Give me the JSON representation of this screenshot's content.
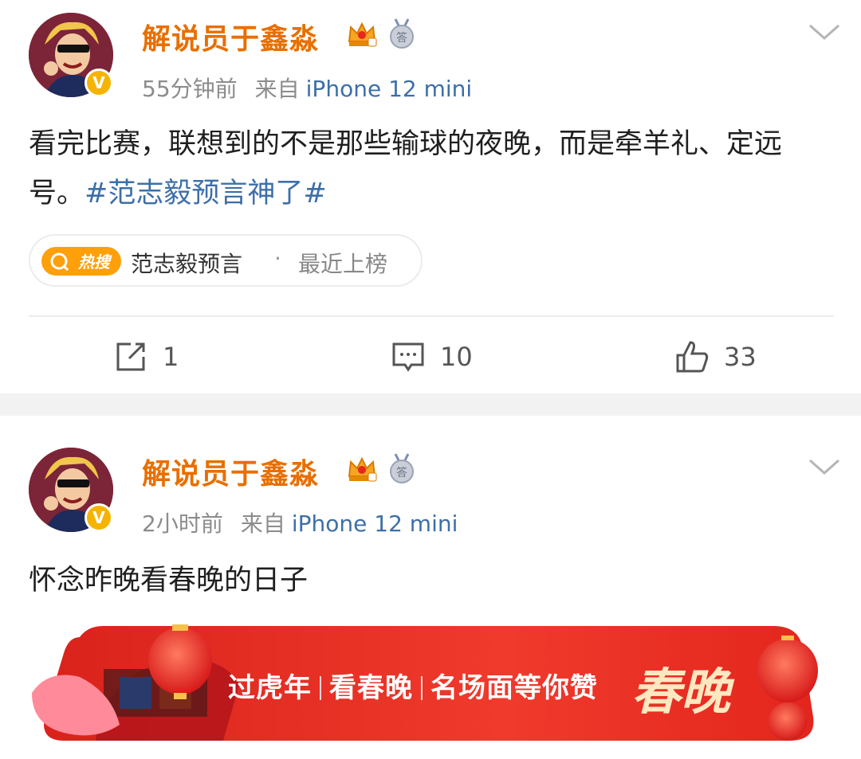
{
  "colors": {
    "username": "#e86f00",
    "link": "#3d6fa8",
    "meta": "#8c8c8c",
    "separator_bg": "#f2f2f2",
    "banner_red": "#e8261f",
    "verified": "#f6b400"
  },
  "posts": [
    {
      "username": "解说员于鑫淼",
      "icons": [
        "avatar",
        "verified-icon",
        "crown-badge-icon",
        "medal-badge-icon",
        "chevron-down-icon"
      ],
      "time": "55分钟前",
      "source_label": "来自",
      "source": "iPhone 12 mini",
      "text": "看完比赛，联想到的不是那些输球的夜晚，而是牵羊礼、定远号。",
      "hashtag": "#范志毅预言神了#",
      "hot_search": {
        "badge": "热搜",
        "topic": "范志毅预言",
        "dot": "·",
        "status": "最近上榜"
      },
      "actions": {
        "repost_count": "1",
        "comment_count": "10",
        "like_count": "33"
      }
    },
    {
      "username": "解说员于鑫淼",
      "time": "2小时前",
      "source_label": "来自",
      "source": "iPhone 12 mini",
      "text": "怀念昨晚看春晚的日子",
      "banner": {
        "part1": "过虎年",
        "part2": "看春晚",
        "part3": "名场面等你赞",
        "logo": "春晚"
      }
    }
  ]
}
